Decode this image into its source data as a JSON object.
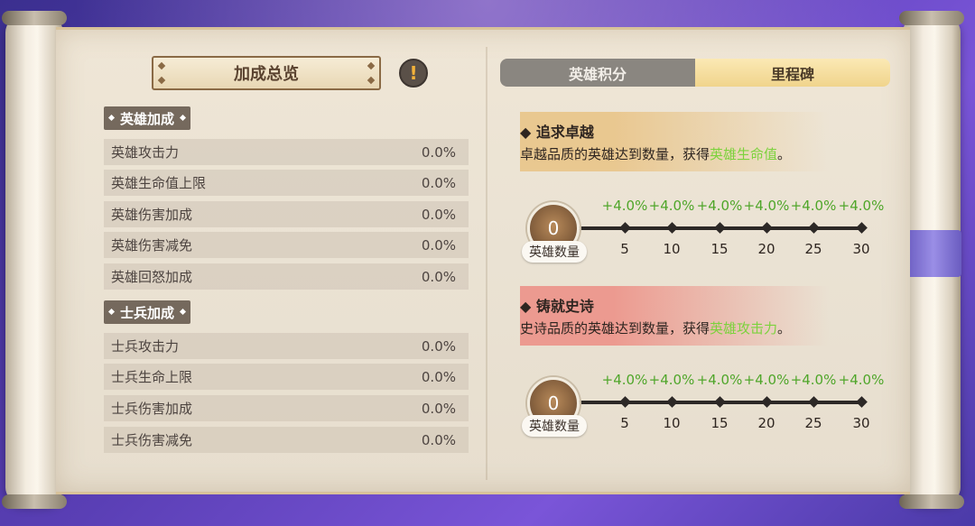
{
  "left_panel": {
    "title": "加成总览",
    "info_icon": "!",
    "hero_section": {
      "label": "英雄加成",
      "rows": [
        {
          "name": "英雄攻击力",
          "value": "0.0%"
        },
        {
          "name": "英雄生命值上限",
          "value": "0.0%"
        },
        {
          "name": "英雄伤害加成",
          "value": "0.0%"
        },
        {
          "name": "英雄伤害减免",
          "value": "0.0%"
        },
        {
          "name": "英雄回怒加成",
          "value": "0.0%"
        }
      ]
    },
    "soldier_section": {
      "label": "士兵加成",
      "rows": [
        {
          "name": "士兵攻击力",
          "value": "0.0%"
        },
        {
          "name": "士兵生命上限",
          "value": "0.0%"
        },
        {
          "name": "士兵伤害加成",
          "value": "0.0%"
        },
        {
          "name": "士兵伤害减免",
          "value": "0.0%"
        }
      ]
    }
  },
  "tabs": [
    {
      "label": "英雄积分",
      "active": false
    },
    {
      "label": "里程碑",
      "active": true
    }
  ],
  "milestones": [
    {
      "title": "追求卓越",
      "desc_prefix": "卓越品质的英雄达到数量，获得",
      "desc_highlight": "英雄生命值",
      "desc_suffix": "。",
      "count": "0",
      "count_label": "英雄数量",
      "bonuses": [
        "+4.0%",
        "+4.0%",
        "+4.0%",
        "+4.0%",
        "+4.0%",
        "+4.0%"
      ],
      "thresholds": [
        "5",
        "10",
        "15",
        "20",
        "25",
        "30"
      ]
    },
    {
      "title": "铸就史诗",
      "desc_prefix": "史诗品质的英雄达到数量，获得",
      "desc_highlight": "英雄攻击力",
      "desc_suffix": "。",
      "count": "0",
      "count_label": "英雄数量",
      "bonuses": [
        "+4.0%",
        "+4.0%",
        "+4.0%",
        "+4.0%",
        "+4.0%",
        "+4.0%"
      ],
      "thresholds": [
        "5",
        "10",
        "15",
        "20",
        "25",
        "30"
      ]
    }
  ],
  "colors": {
    "highlight_green": "#7cd23d",
    "bonus_green": "#4fa62a",
    "active_tab": "#f0d48c",
    "inactive_tab": "#8a8680"
  }
}
